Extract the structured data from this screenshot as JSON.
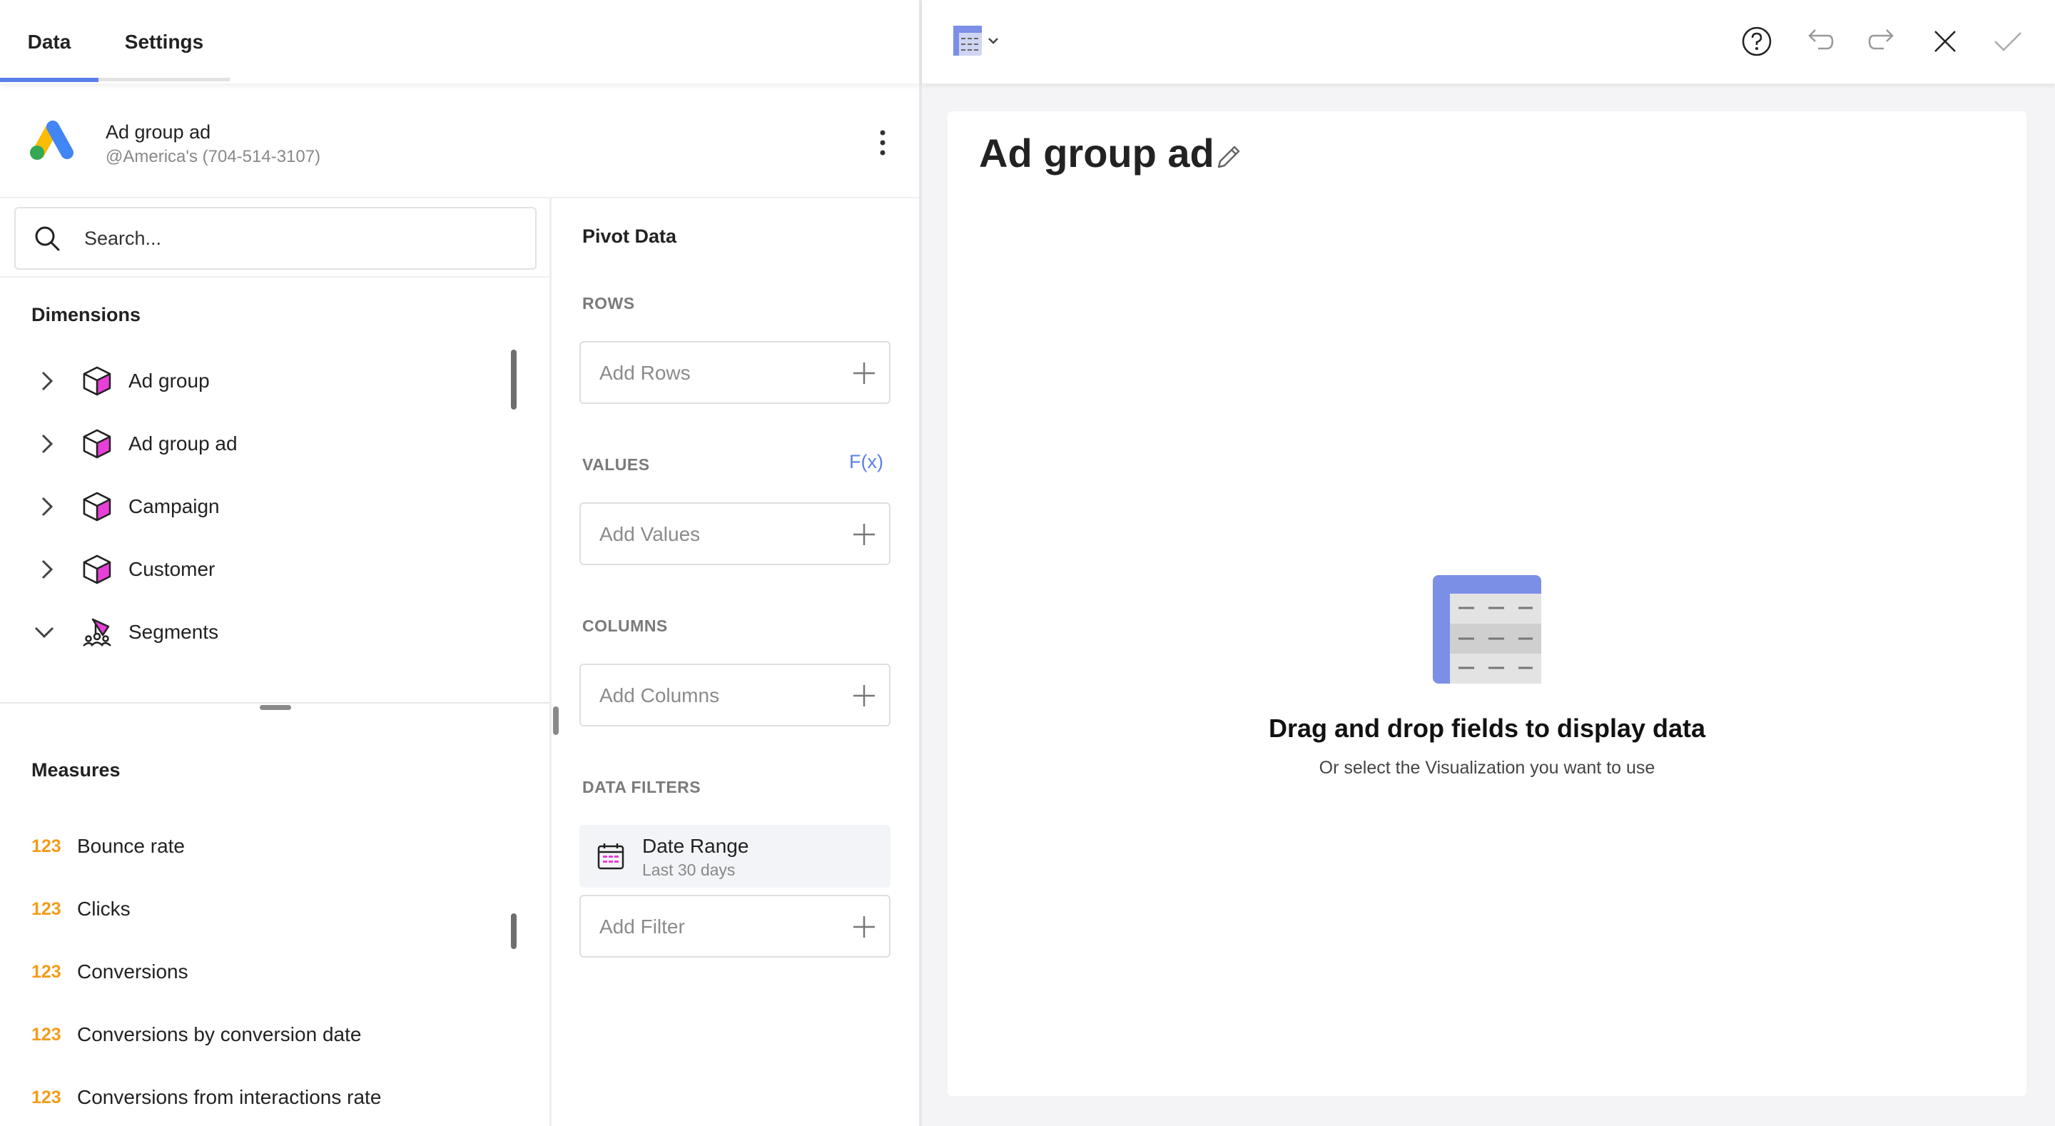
{
  "tabs": {
    "data_label": "Data",
    "settings_label": "Settings"
  },
  "source": {
    "title": "Ad group ad",
    "subtitle": "@America's (704-514-3107)"
  },
  "search": {
    "placeholder": "Search..."
  },
  "dimensions": {
    "title": "Dimensions",
    "items": [
      {
        "label": "Ad group",
        "expanded": false
      },
      {
        "label": "Ad group ad",
        "expanded": false
      },
      {
        "label": "Campaign",
        "expanded": false
      },
      {
        "label": "Customer",
        "expanded": false
      },
      {
        "label": "Segments",
        "expanded": true
      }
    ]
  },
  "measures": {
    "title": "Measures",
    "type_badge": "123",
    "items": [
      {
        "label": "Bounce rate"
      },
      {
        "label": "Clicks"
      },
      {
        "label": "Conversions"
      },
      {
        "label": "Conversions by conversion date"
      },
      {
        "label": "Conversions from interactions rate"
      }
    ]
  },
  "pivot": {
    "title": "Pivot Data",
    "rows_caption": "ROWS",
    "rows_placeholder": "Add Rows",
    "values_caption": "VALUES",
    "values_fx": "F(x)",
    "values_placeholder": "Add Values",
    "columns_caption": "COLUMNS",
    "columns_placeholder": "Add Columns",
    "filters_caption": "DATA FILTERS",
    "date_filter": {
      "title": "Date Range",
      "subtitle": "Last 30 days"
    },
    "filter_placeholder": "Add Filter"
  },
  "visualization": {
    "title": "Ad group ad",
    "empty_title": "Drag and drop fields to display data",
    "empty_subtitle": "Or select the Visualization you want to use"
  },
  "colors": {
    "accent": "#5b7fe8",
    "dimension_icon": "#e83fd8",
    "measure_badge": "#f39c19"
  }
}
